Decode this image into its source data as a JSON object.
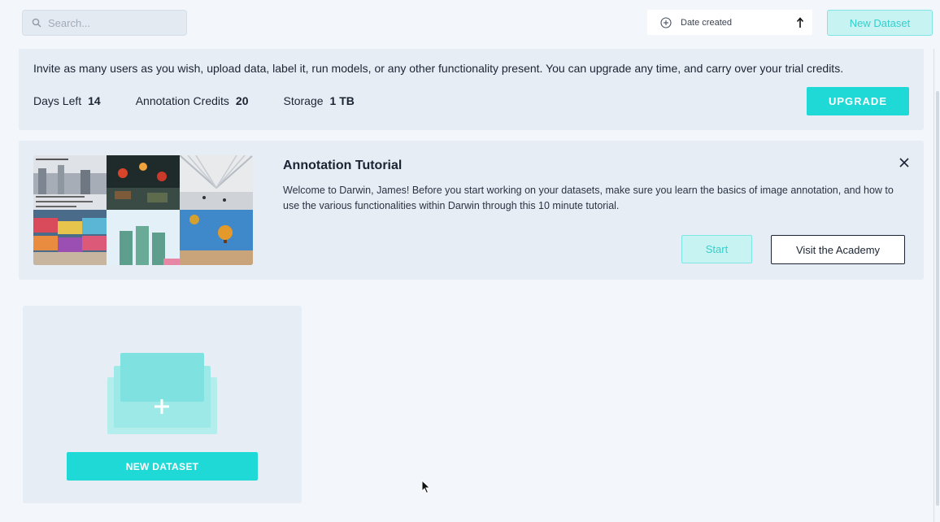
{
  "search": {
    "placeholder": "Search..."
  },
  "sort": {
    "label": "Date created",
    "direction": "ascending"
  },
  "header": {
    "new_dataset_label": "New Dataset"
  },
  "trial": {
    "description": "Invite as many users as you wish, upload data, label it, run models, or any other functionality present. You can upgrade any time, and carry over your trial credits.",
    "stats": [
      {
        "label": "Days Left",
        "value": "14"
      },
      {
        "label": "Annotation Credits",
        "value": "20"
      },
      {
        "label": "Storage",
        "value": "1 TB"
      }
    ],
    "upgrade_label": "UPGRADE"
  },
  "tutorial": {
    "title": "Annotation Tutorial",
    "body": "Welcome to Darwin, James! Before you start working on your datasets, make sure you learn the basics of image annotation, and how to use the various functionalities within Darwin through this 10 minute tutorial.",
    "start_label": "Start",
    "academy_label": "Visit the Academy"
  },
  "new_dataset_card": {
    "button_label": "NEW DATASET"
  },
  "colors": {
    "accent": "#1fd9d6",
    "accent_light": "#c7f3f2",
    "panel": "#e7edf5",
    "background": "#f3f6fb",
    "text": "#1b2433"
  },
  "icons": {
    "search": "search-icon",
    "sort_add": "plus-circle-icon",
    "sort_direction": "arrow-up-icon",
    "close": "close-icon",
    "add": "plus-icon"
  }
}
